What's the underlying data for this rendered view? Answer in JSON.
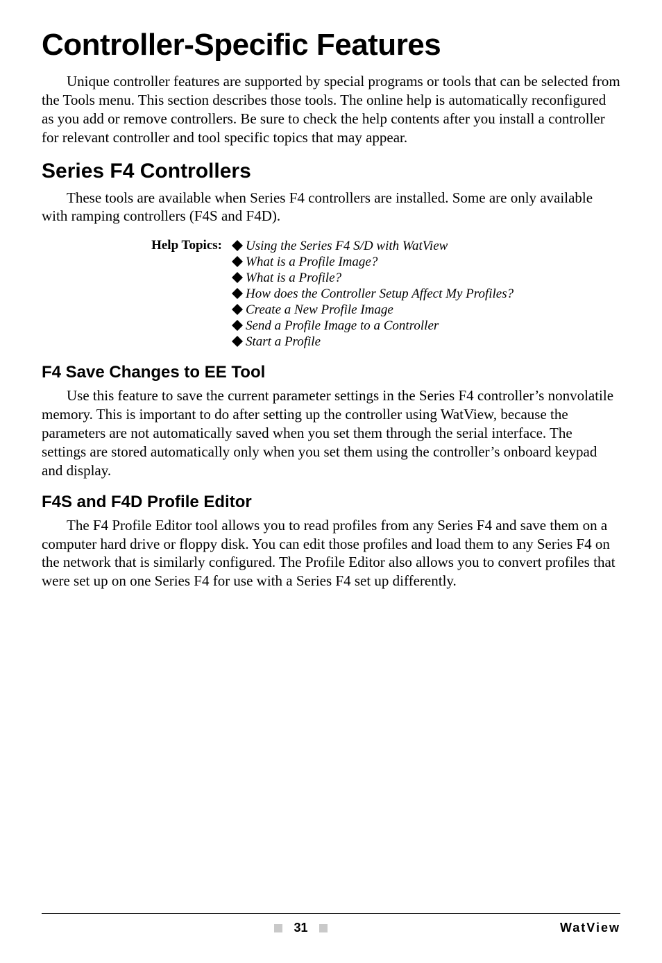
{
  "title": "Controller-Specific Features",
  "intro": "Unique controller features are supported by special programs or tools that can be selected from the Tools menu. This section describes those tools. The online help is automatically reconfigured as you add or remove controllers. Be sure to check the help contents after you install a controller for relevant controller and tool specific topics that may appear.",
  "section1": {
    "heading": "Series F4 Controllers",
    "para": "These tools are available when Series F4 controllers are installed. Some are only available with ramping controllers (F4S and F4D).",
    "help_label": "Help Topics:",
    "help_items": [
      "Using the Series F4 S/D with WatView",
      "What is a Profile Image?",
      "What is a Profile?",
      "How does the Controller Setup Affect My Profiles?",
      "Create a New Profile Image",
      "Send a Profile Image to a Controller",
      "Start a Profile"
    ]
  },
  "section2": {
    "heading": "F4 Save Changes to EE Tool",
    "para": "Use this feature to save the current parameter settings in the Series F4 controller’s nonvolatile memory. This is important to do after setting up the controller using WatView, because the parameters are not automatically saved when you set them through the serial interface. The settings are stored automatically only when you set them using the controller’s onboard keypad and display."
  },
  "section3": {
    "heading": "F4S and F4D Profile Editor",
    "para": "The F4 Profile Editor tool allows you to read profiles from any Series F4 and save them on a computer hard drive or floppy disk. You can edit those profiles and load them to any Series F4 on the network that is similarly configured. The Profile Editor also allows you to convert profiles that were set up on one Series F4 for use with a Series F4 set up differently."
  },
  "footer": {
    "page_number": "31",
    "brand": "WatView"
  }
}
